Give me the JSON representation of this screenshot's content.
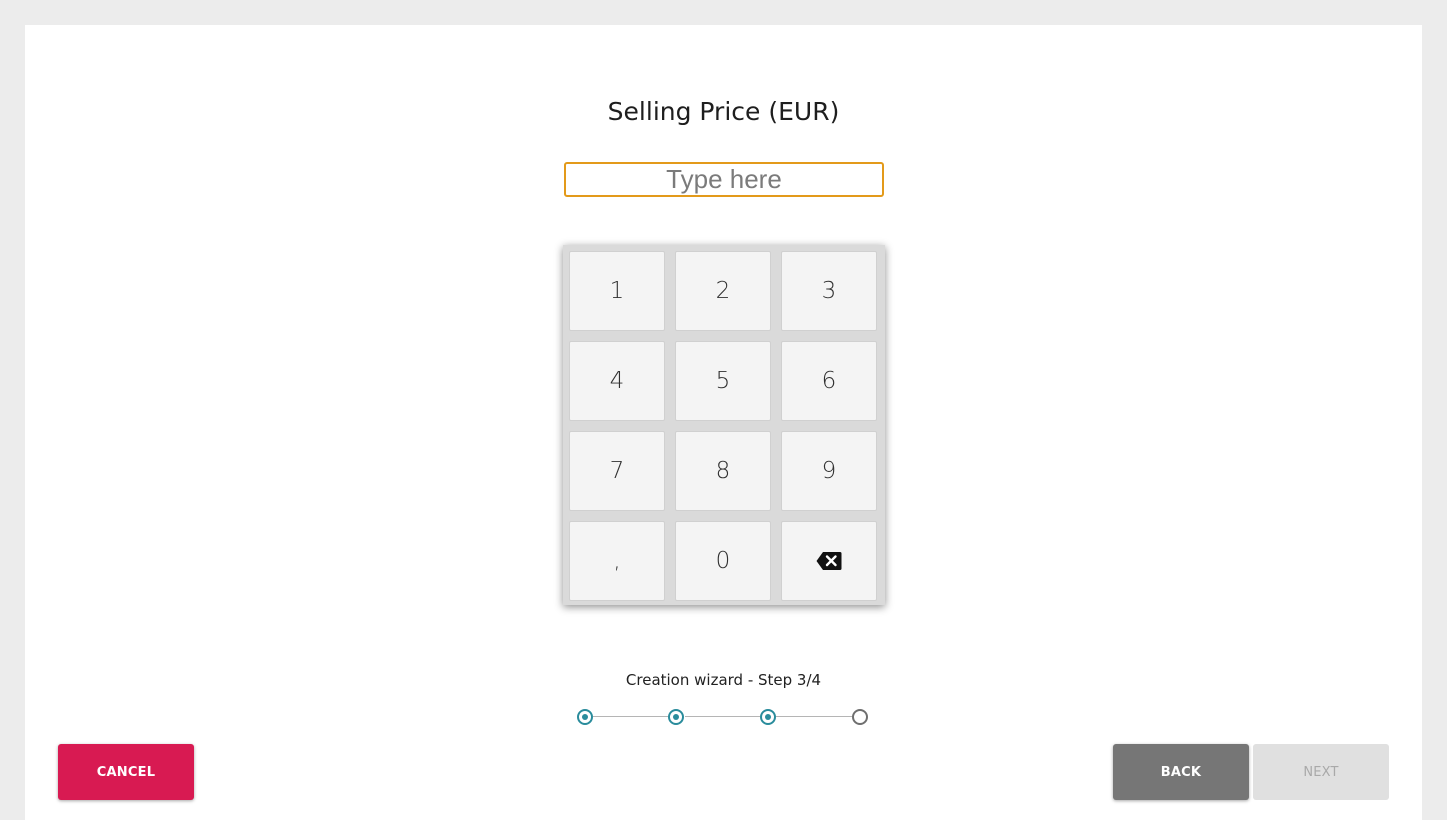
{
  "title": "Selling Price (EUR)",
  "input": {
    "placeholder": "Type here",
    "value": ""
  },
  "keypad": {
    "keys": [
      "1",
      "2",
      "3",
      "4",
      "5",
      "6",
      "7",
      "8",
      "9",
      ",",
      "0"
    ],
    "backspace_icon": "backspace-icon"
  },
  "wizard": {
    "label": "Creation wizard - Step 3/4",
    "current_step": 3,
    "total_steps": 4
  },
  "buttons": {
    "cancel": "CANCEL",
    "back": "BACK",
    "next": "NEXT"
  },
  "colors": {
    "accent": "#2a8c9c",
    "input_border": "#e39a1a",
    "cancel": "#d81a52",
    "back": "#767676",
    "next_disabled": "#e0e0e0"
  }
}
